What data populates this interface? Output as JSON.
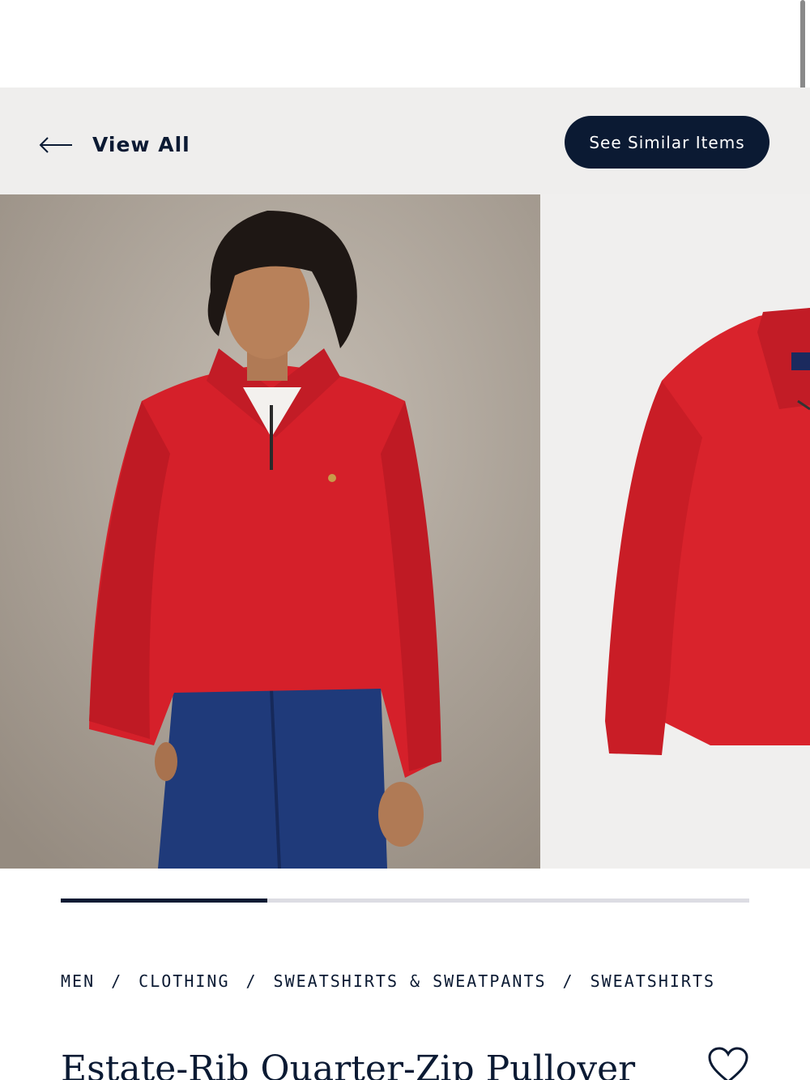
{
  "header": {
    "back_label": "View All",
    "similar_label": "See Similar Items"
  },
  "gallery": {
    "images": [
      {
        "alt": "model wearing red quarter-zip pullover with blue jeans"
      },
      {
        "alt": "red quarter-zip pullover flat view"
      }
    ],
    "progress": 0.3
  },
  "breadcrumb": {
    "items": [
      "MEN",
      "CLOTHING",
      "SWEATSHIRTS & SWEATPANTS",
      "SWEATSHIRTS"
    ],
    "separator": "/"
  },
  "product": {
    "title": "Estate-Rib Quarter-Zip Pullover"
  },
  "colors": {
    "navy": "#0b1a33",
    "red": "#d5202a",
    "header_bg": "#efeeed"
  },
  "icons": {
    "back": "arrow-left-icon",
    "favorite": "heart-icon"
  }
}
